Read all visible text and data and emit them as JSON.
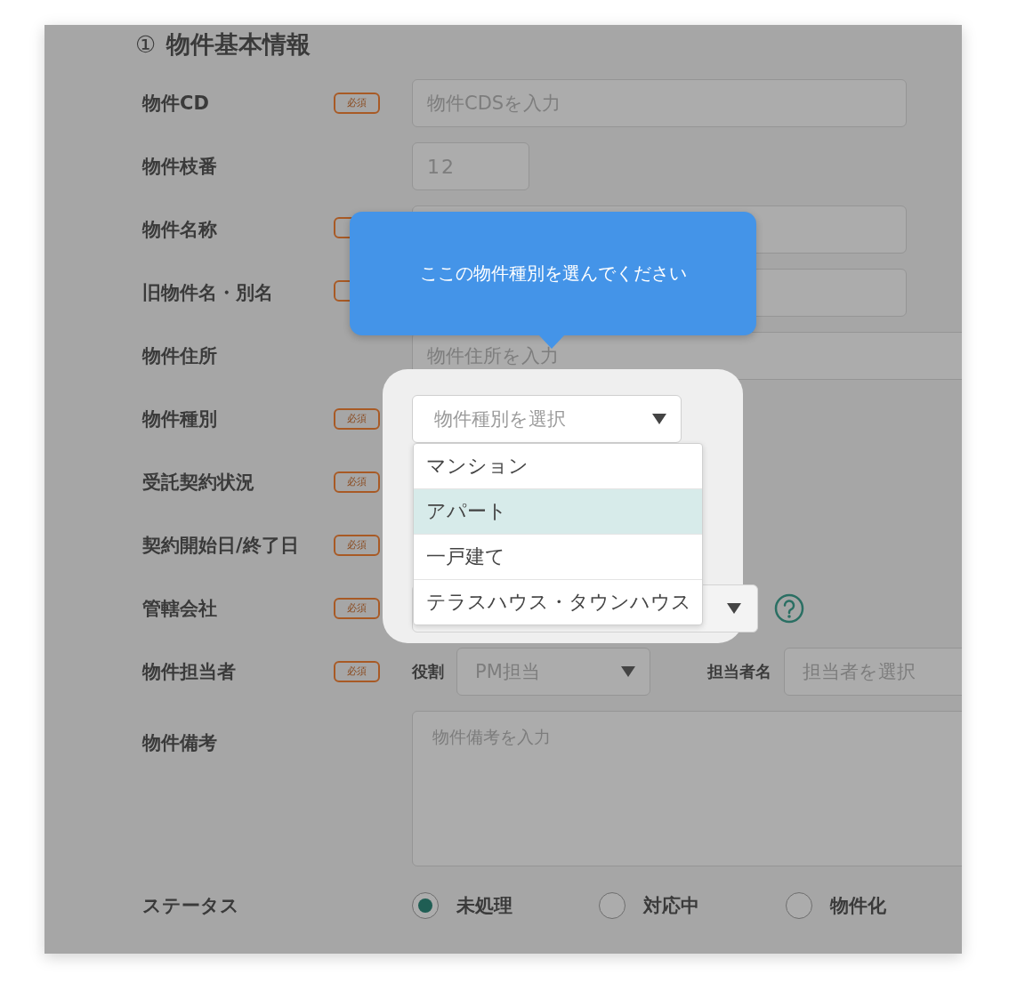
{
  "section": {
    "number": "①",
    "title": "物件基本情報"
  },
  "fields": [
    {
      "label": "物件CD",
      "required": true,
      "badge": "必須",
      "kind": "text",
      "placeholder": "物件CDSを入力"
    },
    {
      "label": "物件枝番",
      "required": false,
      "kind": "short",
      "value": "12"
    },
    {
      "label": "物件名称",
      "required": true,
      "kind": "text"
    },
    {
      "label": "旧物件名・別名",
      "required": true,
      "kind": "text"
    },
    {
      "label": "物件住所",
      "required": false,
      "kind": "wide",
      "placeholder": "物件住所を入力"
    },
    {
      "label": "物件種別",
      "required": true,
      "badge": "必須",
      "kind": "select",
      "placeholder": "物件種別を選択"
    },
    {
      "label": "受託契約状況",
      "required": true,
      "badge": "必須",
      "kind": "covered"
    },
    {
      "label": "契約開始日/終了日",
      "required": true,
      "badge": "必須",
      "kind": "covered"
    },
    {
      "label": "管轄会社",
      "required": true,
      "badge": "必須",
      "kind": "company"
    },
    {
      "label": "物件担当者",
      "required": true,
      "badge": "必須",
      "kind": "staff",
      "role_label": "役割",
      "role_value": "PM担当",
      "person_label": "担当者名",
      "person_placeholder": "担当者を選択"
    },
    {
      "label": "物件備考",
      "required": false,
      "kind": "textarea",
      "placeholder": "物件備考を入力"
    },
    {
      "label": "ステータス",
      "required": false,
      "kind": "radios",
      "options": [
        {
          "label": "未処理",
          "selected": true
        },
        {
          "label": "対応中",
          "selected": false
        },
        {
          "label": "物件化",
          "selected": false
        }
      ]
    }
  ],
  "dropdown": {
    "options": [
      {
        "label": "マンション",
        "selected": false
      },
      {
        "label": "アパート",
        "selected": true
      },
      {
        "label": "一戸建て",
        "selected": false
      },
      {
        "label": "テラスハウス・タウンハウス",
        "selected": false
      }
    ]
  },
  "tooltip": {
    "text": "ここの物件種別を選んでください"
  }
}
